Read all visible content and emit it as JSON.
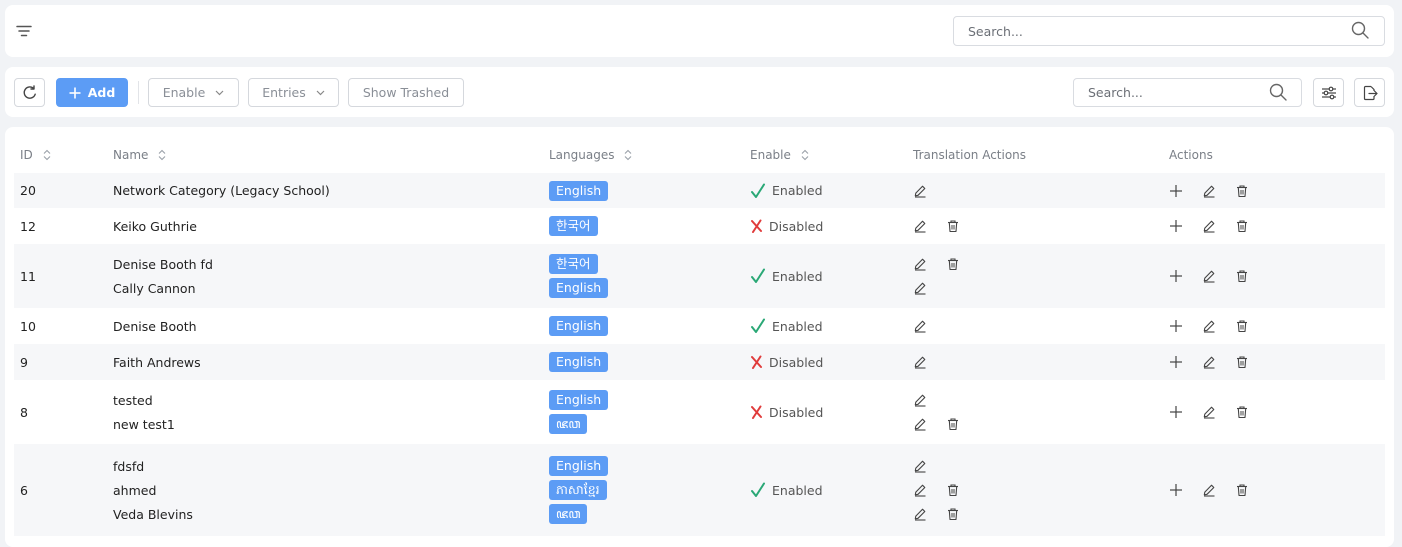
{
  "top": {
    "search_placeholder": "Search..."
  },
  "toolbar": {
    "add_label": "Add",
    "enable_label": "Enable",
    "entries_label": "Entries",
    "show_trashed_label": "Show Trashed",
    "search_placeholder": "Search..."
  },
  "table": {
    "headers": {
      "id": "ID",
      "name": "Name",
      "languages": "Languages",
      "enable": "Enable",
      "translation_actions": "Translation Actions",
      "actions": "Actions"
    },
    "rows": [
      {
        "id": "20",
        "names": [
          "Network Category (Legacy School)"
        ],
        "languages": [
          "English"
        ],
        "status": "Enabled"
      },
      {
        "id": "12",
        "names": [
          "Keiko Guthrie"
        ],
        "languages": [
          "한국어"
        ],
        "status": "Disabled"
      },
      {
        "id": "11",
        "names": [
          "Denise Booth fd",
          "Cally Cannon"
        ],
        "languages": [
          "한국어",
          "English"
        ],
        "status": "Enabled"
      },
      {
        "id": "10",
        "names": [
          "Denise Booth"
        ],
        "languages": [
          "English"
        ],
        "status": "Enabled"
      },
      {
        "id": "9",
        "names": [
          "Faith Andrews"
        ],
        "languages": [
          "English"
        ],
        "status": "Disabled"
      },
      {
        "id": "8",
        "names": [
          "tested",
          "new test1"
        ],
        "languages": [
          "English",
          "ꦗꦮ"
        ],
        "status": "Disabled"
      },
      {
        "id": "6",
        "names": [
          "fdsfd",
          "ahmed",
          "Veda Blevins"
        ],
        "languages": [
          "English",
          "ភាសាខ្មែរ",
          "ꦗꦮ"
        ],
        "status": "Enabled"
      }
    ]
  },
  "colors": {
    "primary": "#5c9cf5",
    "enabled_check": "#2aa876",
    "disabled_x": "#e03b3b"
  }
}
